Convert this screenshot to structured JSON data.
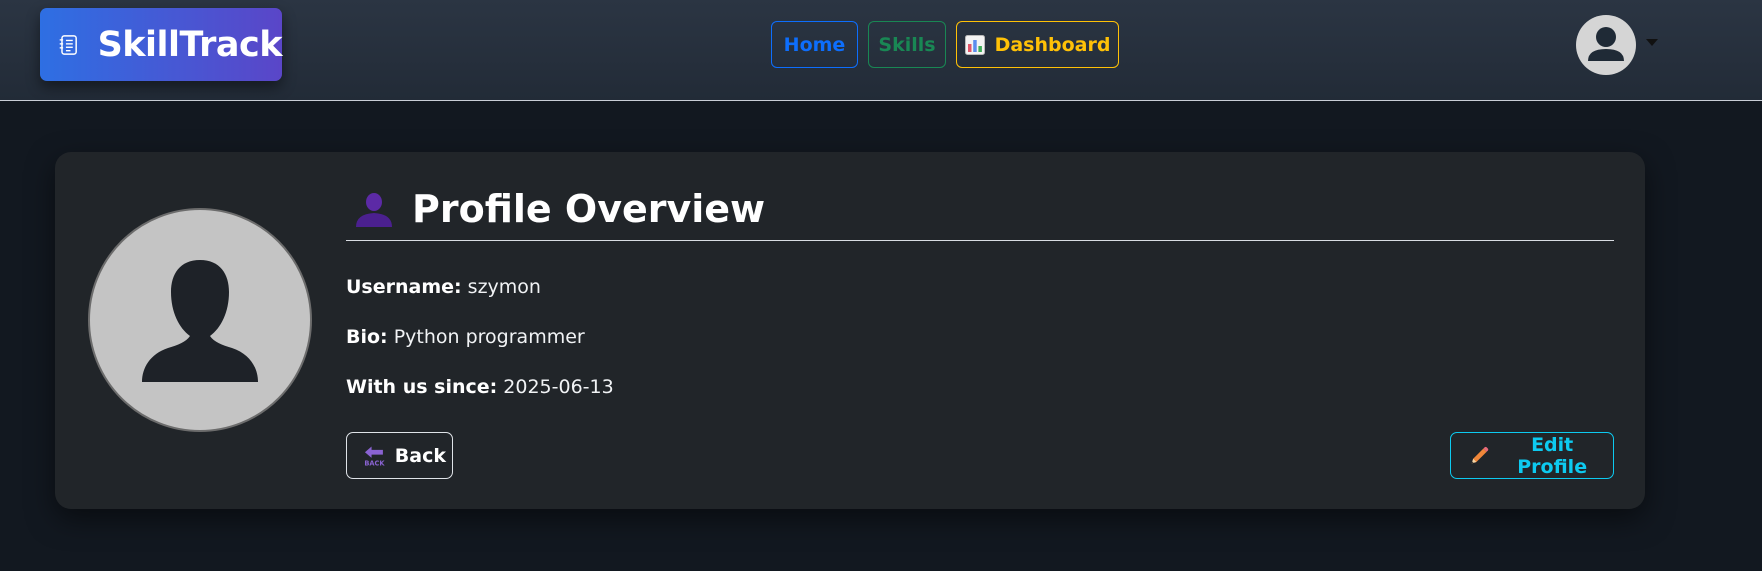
{
  "brand": {
    "name": "SkillTrack",
    "icon": "notebook-icon"
  },
  "nav": {
    "home": "Home",
    "skills": "Skills",
    "dashboard": "Dashboard",
    "dashboard_icon": "bar-chart-icon"
  },
  "user_menu": {
    "icon": "user-avatar-icon"
  },
  "profile": {
    "title": "Profile Overview",
    "title_icon": "bust-in-silhouette-icon",
    "username_label": "Username:",
    "username": "szymon",
    "bio_label": "Bio:",
    "bio": "Python programmer",
    "since_label": "With us since:",
    "since": "2025-06-13"
  },
  "actions": {
    "back": "Back",
    "back_icon_text": "BACK",
    "edit": "Edit Profile"
  },
  "colors": {
    "home": "#0d6efd",
    "skills": "#198754",
    "dashboard": "#ffc107",
    "edit": "#0dcaf0",
    "brand_start": "#2e6fe3",
    "brand_end": "#5a46c8"
  }
}
